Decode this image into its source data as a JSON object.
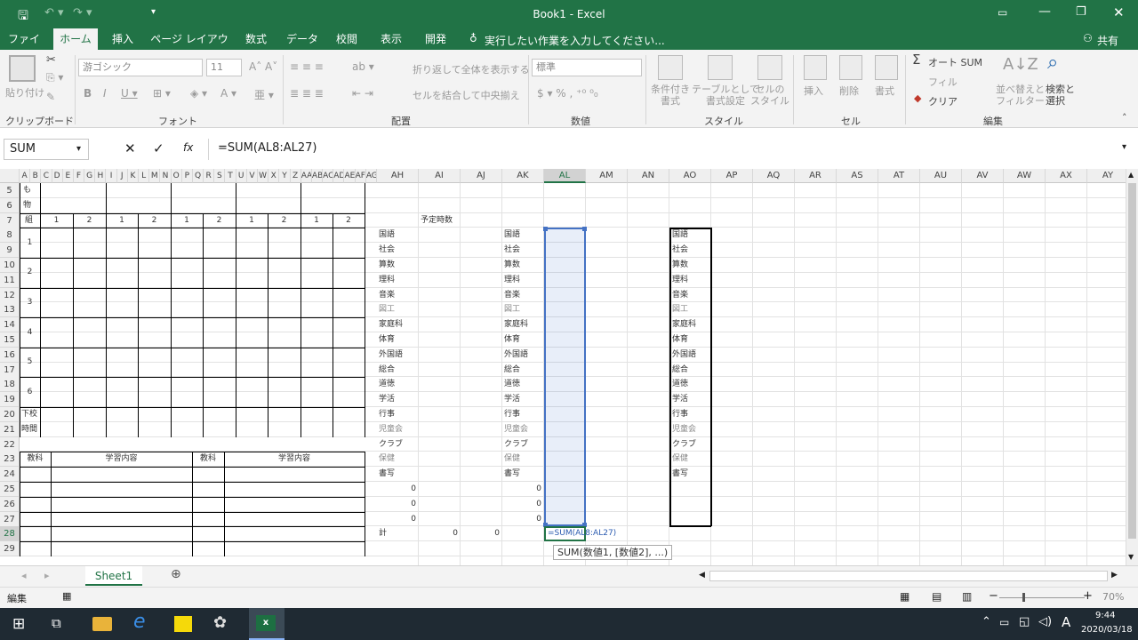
{
  "titlebar": {
    "title": "Book1 - Excel"
  },
  "tabs": [
    "ファイル",
    "ホーム",
    "挿入",
    "ページ レイアウト",
    "数式",
    "データ",
    "校閲",
    "表示",
    "開発"
  ],
  "tellme": "実行したい作業を入力してください...",
  "share": "共有",
  "ribbon": {
    "paste": "貼り付け",
    "clipboard": "クリップボード",
    "font_name": "游ゴシック",
    "font_size": "11",
    "font_group": "フォント",
    "wrap": "折り返して全体を表示する",
    "merge": "セルを結合して中央揃え",
    "align_group": "配置",
    "number_format": "標準",
    "number_group": "数値",
    "cond_format": "条件付き\n書式",
    "table_format": "テーブルとして\n書式設定",
    "cell_style": "セルの\nスタイル",
    "style_group": "スタイル",
    "insert": "挿入",
    "delete": "削除",
    "format": "書式",
    "cells_group": "セル",
    "autosum": "オート SUM",
    "fill": "フィル",
    "clear": "クリア",
    "sort": "並べ替えと\nフィルター",
    "find": "検索と\n選択",
    "edit_group": "編集"
  },
  "formula_bar": {
    "namebox": "SUM",
    "formula": "=SUM(AL8:AL27)"
  },
  "columns": [
    "AH",
    "AI",
    "AJ",
    "AK",
    "AL",
    "AM",
    "AN",
    "AO",
    "AP",
    "AQ",
    "AR",
    "AS",
    "AT",
    "AU",
    "AV",
    "AW",
    "AX",
    "AY"
  ],
  "left_columns": [
    "A",
    "B",
    "C",
    "D",
    "E",
    "F",
    "G",
    "H",
    "I",
    "J",
    "K",
    "L",
    "M",
    "N",
    "O",
    "P",
    "Q",
    "R",
    "S",
    "T",
    "U",
    "V",
    "W",
    "X",
    "Y",
    "Z",
    "AA",
    "AB",
    "AC",
    "AD",
    "AE",
    "AF",
    "AG"
  ],
  "rows": [
    "5",
    "6",
    "7",
    "8",
    "9",
    "10",
    "11",
    "12",
    "13",
    "14",
    "15",
    "16",
    "17",
    "18",
    "19",
    "20",
    "21",
    "22",
    "23",
    "24",
    "25",
    "26",
    "27",
    "28",
    "29"
  ],
  "left_table": {
    "mono": [
      "も",
      "物"
    ],
    "kumi": "組",
    "kumi_nums": [
      "1",
      "2",
      "1",
      "2",
      "1",
      "2",
      "1",
      "2",
      "1",
      "2"
    ],
    "periods": [
      "1",
      "2",
      "3",
      "4",
      "5",
      "6"
    ],
    "dismiss": [
      "下校",
      "時間"
    ],
    "bottom_headers": [
      "教科",
      "学習内容",
      "教科",
      "学習内容"
    ]
  },
  "subjects": [
    "国語",
    "社会",
    "算数",
    "理科",
    "音楽",
    "図工",
    "家庭科",
    "体育",
    "外国語",
    "総合",
    "道徳",
    "学活",
    "行事",
    "児童会",
    "クラブ",
    "保健",
    "書写"
  ],
  "yotei": "予定時数",
  "zeros": [
    "0",
    "0",
    "0"
  ],
  "total_label": "計",
  "totals": [
    "0",
    "0"
  ],
  "editing": "=SUM(AL8:AL27)",
  "tooltip": "SUM(数値1, [数値2], ...)",
  "sheet_tab": "Sheet1",
  "status": {
    "mode": "編集",
    "zoom": "70%"
  },
  "taskbar": {
    "time": "9:44",
    "date": "2020/03/18",
    "ime": "A"
  }
}
